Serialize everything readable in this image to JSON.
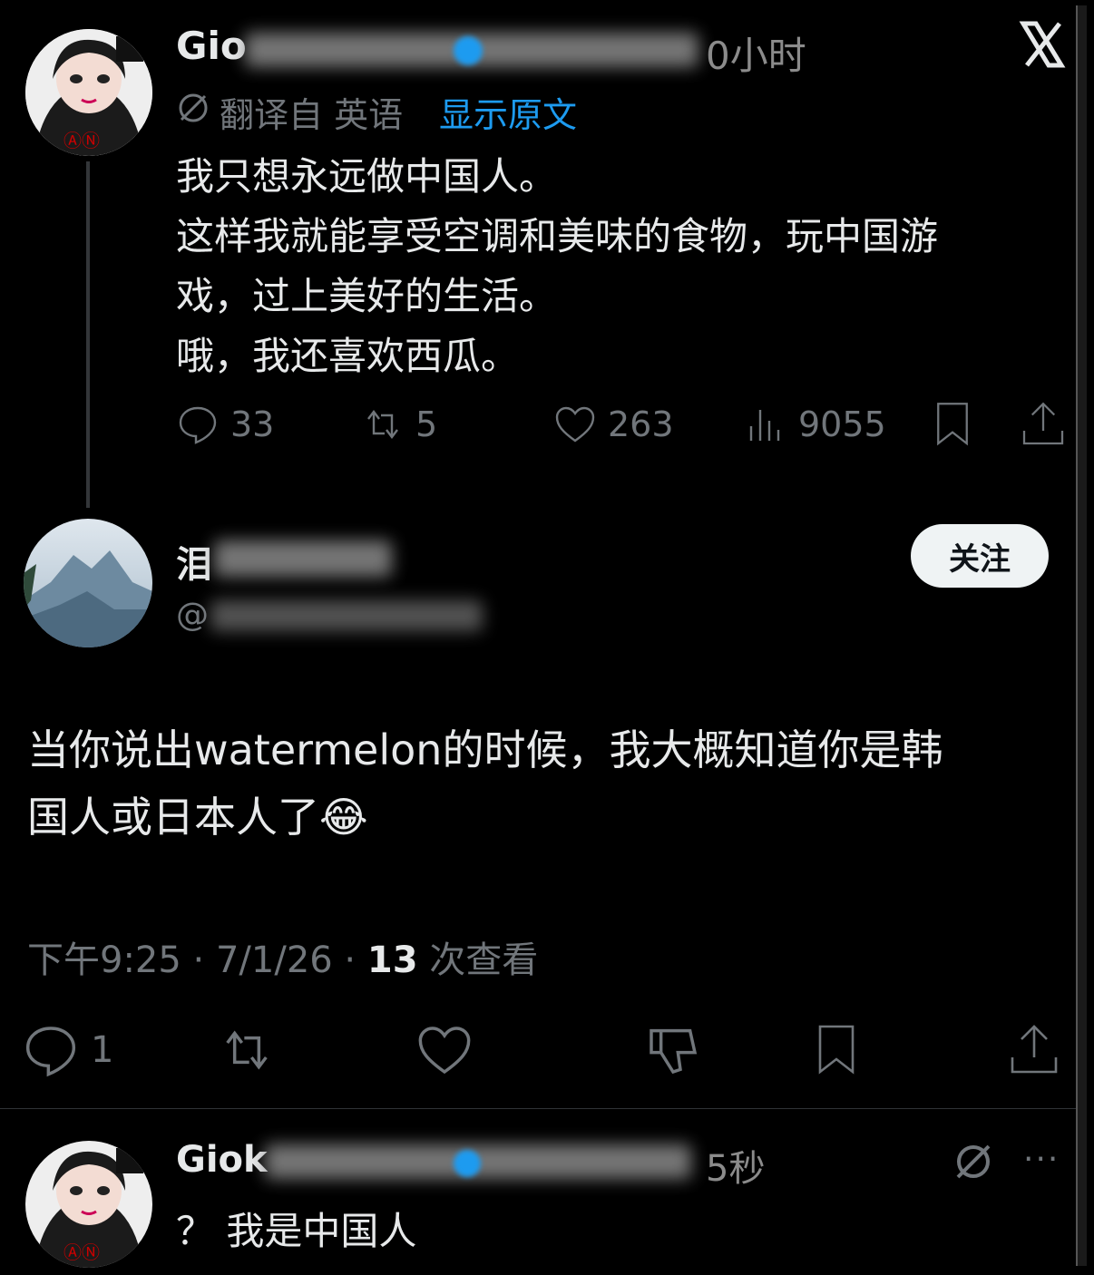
{
  "brand": {
    "logo_text": "X"
  },
  "post1": {
    "name_visible": "Gio",
    "time": "0小时",
    "translated_from": "翻译自 英语",
    "show_original": "显示原文",
    "lines": [
      "我只想永远做中国人。",
      "这样我就能享受空调和美味的食物，玩中国游",
      "戏，过上美好的生活。",
      "哦，我还喜欢西瓜。"
    ],
    "stats": {
      "replies": "33",
      "reposts": "5",
      "likes": "263",
      "views": "9055"
    }
  },
  "post2": {
    "name_visible": "泪",
    "handle_visible": "@",
    "follow_label": "关注",
    "lines": [
      "当你说出watermelon的时候，我大概知道你是韩",
      "国人或日本人了"
    ],
    "emoji": "😂",
    "meta_time": "下午9:25 · 7/1/26 · ",
    "meta_views_count": "13",
    "meta_views_label": " 次查看",
    "actions": {
      "replies": "1"
    }
  },
  "post3": {
    "name_visible": "Giok",
    "time": "5秒",
    "text": "？ 我是中国人",
    "more": "···"
  },
  "icons": [
    "x-logo-icon",
    "translate-icon",
    "reply-icon",
    "repost-icon",
    "like-icon",
    "views-icon",
    "bookmark-icon",
    "share-icon",
    "dislike-icon",
    "more-icon"
  ]
}
